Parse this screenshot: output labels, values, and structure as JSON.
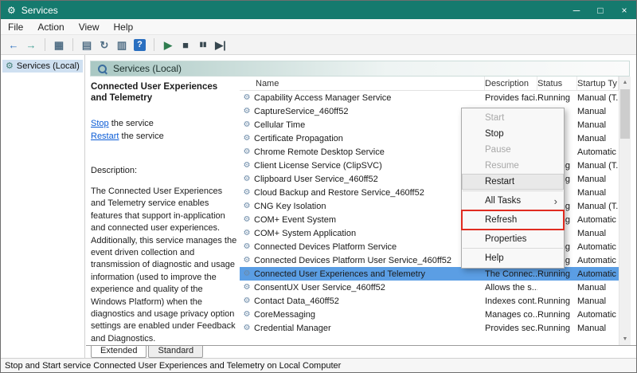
{
  "window": {
    "title": "Services",
    "icon_glyph": "⚙",
    "controls": [
      {
        "name": "minimize",
        "glyph": "─"
      },
      {
        "name": "maximize",
        "glyph": "□"
      },
      {
        "name": "close",
        "glyph": "×"
      }
    ]
  },
  "menu_bar": [
    "File",
    "Action",
    "View",
    "Help"
  ],
  "toolbar": {
    "icons": [
      {
        "name": "back",
        "glyph": "←",
        "color": "#2a6fc0"
      },
      {
        "name": "forward",
        "glyph": "→",
        "color": "#3f9d92"
      },
      {
        "separator": true
      },
      {
        "name": "show-console-tree",
        "glyph": "▦",
        "color": "#4f6d84"
      },
      {
        "separator": true
      },
      {
        "name": "properties",
        "glyph": "▤",
        "color": "#4f6d84"
      },
      {
        "name": "refresh",
        "glyph": "↻",
        "color": "#4f6d84"
      },
      {
        "name": "export-list",
        "glyph": "▥",
        "color": "#4f6d84"
      },
      {
        "name": "help",
        "glyph": "?",
        "color": "#ffffff",
        "bg": "#2a6fc0"
      },
      {
        "separator": true
      },
      {
        "name": "start-service",
        "glyph": "▶",
        "color": "#2f7d4f"
      },
      {
        "name": "stop-service",
        "glyph": "■",
        "color": "#37474f"
      },
      {
        "name": "pause-service",
        "glyph": "▮▮",
        "color": "#37474f",
        "size": "8px"
      },
      {
        "name": "restart-service",
        "glyph": "▶|",
        "color": "#37474f"
      }
    ]
  },
  "tree": {
    "label": "Services (Local)",
    "icon_glyph": "⚙"
  },
  "pane_header": {
    "label": "Services (Local)"
  },
  "detail": {
    "title": "Connected User Experiences and Telemetry",
    "stop_link": "Stop",
    "stop_rest": " the service",
    "restart_link": "Restart",
    "restart_rest": " the service",
    "description_label": "Description:",
    "description_text": "The Connected User Experiences and Telemetry service enables features that support in-application and connected user experiences. Additionally, this service manages the event driven collection and transmission of diagnostic and usage information (used to improve the experience and quality of the Windows Platform) when the diagnostics and usage privacy option settings are enabled under Feedback and Diagnostics."
  },
  "table": {
    "headers": [
      "Name",
      "Description",
      "Status",
      "Startup Ty"
    ],
    "row_icon": "⚙",
    "rows": [
      {
        "name": "Capability Access Manager Service",
        "description": "Provides faci...",
        "status": "Running",
        "startup": "Manual (T...",
        "selected": false
      },
      {
        "name": "CaptureService_460ff52",
        "description": "",
        "status": "",
        "startup": "Manual",
        "selected": false
      },
      {
        "name": "Cellular Time",
        "description": "",
        "status": "",
        "startup": "Manual",
        "selected": false
      },
      {
        "name": "Certificate Propagation",
        "description": "",
        "status": "",
        "startup": "Manual",
        "selected": false
      },
      {
        "name": "Chrome Remote Desktop Service",
        "description": "",
        "status": "",
        "startup": "Automatic",
        "selected": false
      },
      {
        "name": "Client License Service (ClipSVC)",
        "description": "",
        "status": "Running",
        "startup": "Manual (T...",
        "selected": false
      },
      {
        "name": "Clipboard User Service_460ff52",
        "description": "",
        "status": "Running",
        "startup": "Manual",
        "selected": false
      },
      {
        "name": "Cloud Backup and Restore Service_460ff52",
        "description": "",
        "status": "",
        "startup": "Manual",
        "selected": false
      },
      {
        "name": "CNG Key Isolation",
        "description": "",
        "status": "Running",
        "startup": "Manual (T...",
        "selected": false
      },
      {
        "name": "COM+ Event System",
        "description": "",
        "status": "Running",
        "startup": "Automatic",
        "selected": false
      },
      {
        "name": "COM+ System Application",
        "description": "",
        "status": "",
        "startup": "Manual",
        "selected": false
      },
      {
        "name": "Connected Devices Platform Service",
        "description": "",
        "status": "Running",
        "startup": "Automatic",
        "selected": false
      },
      {
        "name": "Connected Devices Platform User Service_460ff52",
        "description": "",
        "status": "Running",
        "startup": "Automatic",
        "selected": false
      },
      {
        "name": "Connected User Experiences and Telemetry",
        "description": "The Connec...",
        "status": "Running",
        "startup": "Automatic",
        "selected": true
      },
      {
        "name": "ConsentUX User Service_460ff52",
        "description": "Allows the s...",
        "status": "",
        "startup": "Manual",
        "selected": false
      },
      {
        "name": "Contact Data_460ff52",
        "description": "Indexes cont...",
        "status": "Running",
        "startup": "Manual",
        "selected": false
      },
      {
        "name": "CoreMessaging",
        "description": "Manages co...",
        "status": "Running",
        "startup": "Automatic",
        "selected": false
      },
      {
        "name": "Credential Manager",
        "description": "Provides sec...",
        "status": "Running",
        "startup": "Manual",
        "selected": false
      }
    ]
  },
  "context_menu": {
    "submenu_arrow": "›",
    "items": [
      {
        "label": "Start",
        "disabled": true
      },
      {
        "label": "Stop",
        "disabled": false
      },
      {
        "label": "Pause",
        "disabled": true
      },
      {
        "label": "Resume",
        "disabled": true
      },
      {
        "label": "Restart",
        "disabled": false,
        "hover": true
      },
      {
        "separator": true
      },
      {
        "label": "All Tasks",
        "disabled": false,
        "submenu": true
      },
      {
        "separator": true
      },
      {
        "label": "Refresh",
        "disabled": false,
        "annotated": true
      },
      {
        "separator": true
      },
      {
        "label": "Properties",
        "disabled": false
      },
      {
        "separator": true
      },
      {
        "label": "Help",
        "disabled": false
      }
    ]
  },
  "scrollbar": {
    "up_glyph": "▲",
    "down_glyph": "▼"
  },
  "bottom_tabs": [
    "Extended",
    "Standard"
  ],
  "status_bar": {
    "text": "Stop and Start service Connected User Experiences and Telemetry on Local Computer"
  },
  "colors": {
    "titlebar": "#157a6e",
    "selection": "#5b9ee4",
    "link": "#0b5cd6",
    "annotation": "#e02b20"
  }
}
